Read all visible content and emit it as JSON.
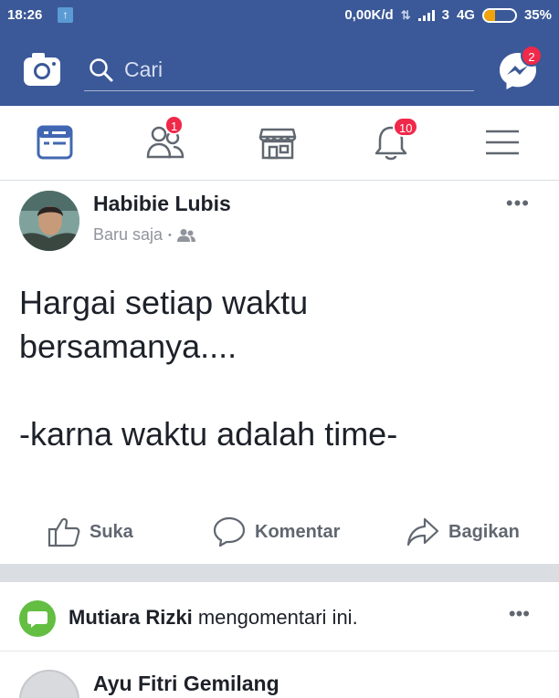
{
  "status_bar": {
    "time": "18:26",
    "upload_icon": "arrow-up-icon",
    "data_speed": "0,00K/d",
    "sim": "3",
    "network": "4G",
    "battery_percent": "35%",
    "battery_level": 0.35
  },
  "header": {
    "camera_icon": "camera-icon",
    "search_placeholder": "Cari",
    "messenger_icon": "messenger-icon",
    "messenger_badge": "2"
  },
  "tabs": [
    {
      "name": "news-feed",
      "icon": "news-feed-icon",
      "badge": "",
      "active": true
    },
    {
      "name": "friends",
      "icon": "friends-icon",
      "badge": "1",
      "active": false
    },
    {
      "name": "marketplace",
      "icon": "marketplace-icon",
      "badge": "",
      "active": false
    },
    {
      "name": "notifications",
      "icon": "bell-icon",
      "badge": "10",
      "active": false
    },
    {
      "name": "menu",
      "icon": "hamburger-menu-icon",
      "badge": "",
      "active": false
    }
  ],
  "post": {
    "author": "Habibie Lubis",
    "time": "Baru saja",
    "separator": "•",
    "audience_icon": "friends-audience-icon",
    "more": "•••",
    "text": "Hargai setiap waktu\nbersamanya....\n\n-karna waktu adalah time-",
    "actions": {
      "like": "Suka",
      "comment": "Komentar",
      "share": "Bagikan"
    }
  },
  "activity": {
    "name": "Mutiara Rizki",
    "text": " mengomentari ini.",
    "more": "•••"
  },
  "next_post": {
    "author": "Ayu Fitri Gemilang"
  },
  "colors": {
    "brand": "#3b5998",
    "badge": "#f02849",
    "active_tab": "#4267b2",
    "comment_icon": "#63be42"
  }
}
